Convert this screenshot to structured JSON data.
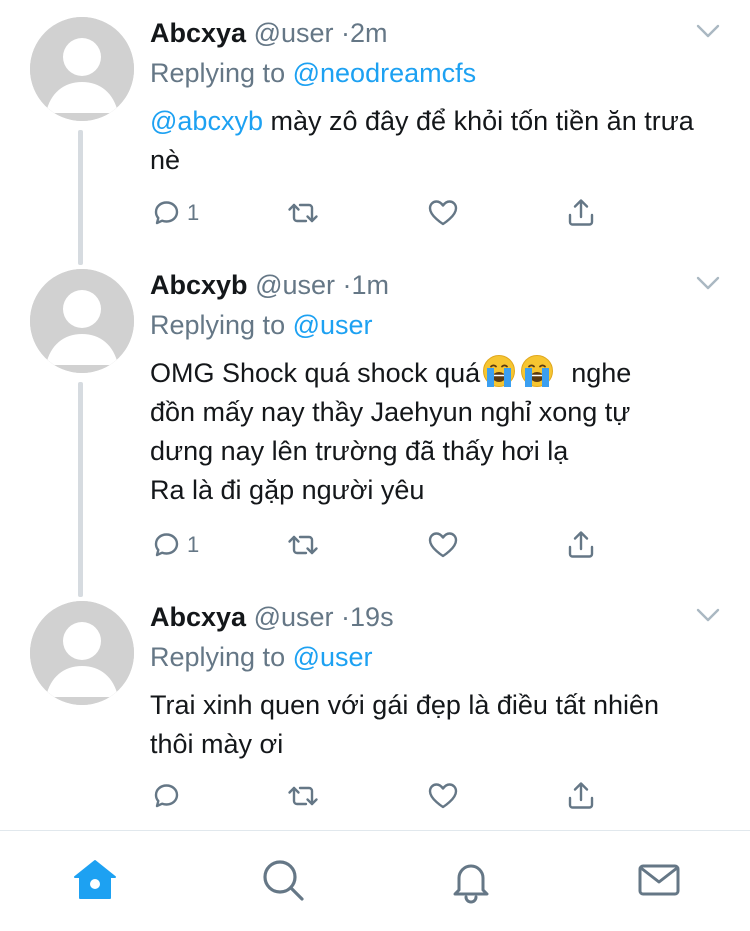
{
  "tweets": [
    {
      "name": "Abcxya",
      "handle": "@user",
      "sep": "·",
      "time": "2m",
      "replying_prefix": "Replying to",
      "replying_to": "@neodreamcfs",
      "mention": "@abcxyb",
      "text": "mày zô đây để khỏi tốn tiền ăn trưa nè",
      "reply_count": "1"
    },
    {
      "name": "Abcxyb",
      "handle": "@user",
      "sep": "·",
      "time": "1m",
      "replying_prefix": "Replying to",
      "replying_to": "@user",
      "text_line1": "OMG Shock quá shock quá",
      "text_line1_after": "nghe",
      "text_line2": "đồn mấy nay thầy Jaehyun nghỉ xong tự",
      "text_line3": "dưng nay lên trường đã thấy hơi lạ",
      "text_line4": "Ra là đi gặp người yêu",
      "reply_count": "1",
      "emoji": [
        "crying-face",
        "crying-face"
      ]
    },
    {
      "name": "Abcxya",
      "handle": "@user",
      "sep": "·",
      "time": "19s",
      "replying_prefix": "Replying to",
      "replying_to": "@user",
      "text": "Trai xinh quen với gái đẹp là điều tất nhiên thôi mày ơi",
      "reply_count": ""
    }
  ],
  "icons": {
    "actions": [
      "reply-icon",
      "retweet-icon",
      "like-icon",
      "share-icon"
    ],
    "tabs": [
      "home-icon",
      "search-icon",
      "notifications-icon",
      "messages-icon"
    ]
  },
  "colors": {
    "accent": "#1da1f2",
    "muted": "#657786",
    "text": "#14171a",
    "avatar": "#d1d1d1",
    "thread_line": "#d6dbe0"
  }
}
